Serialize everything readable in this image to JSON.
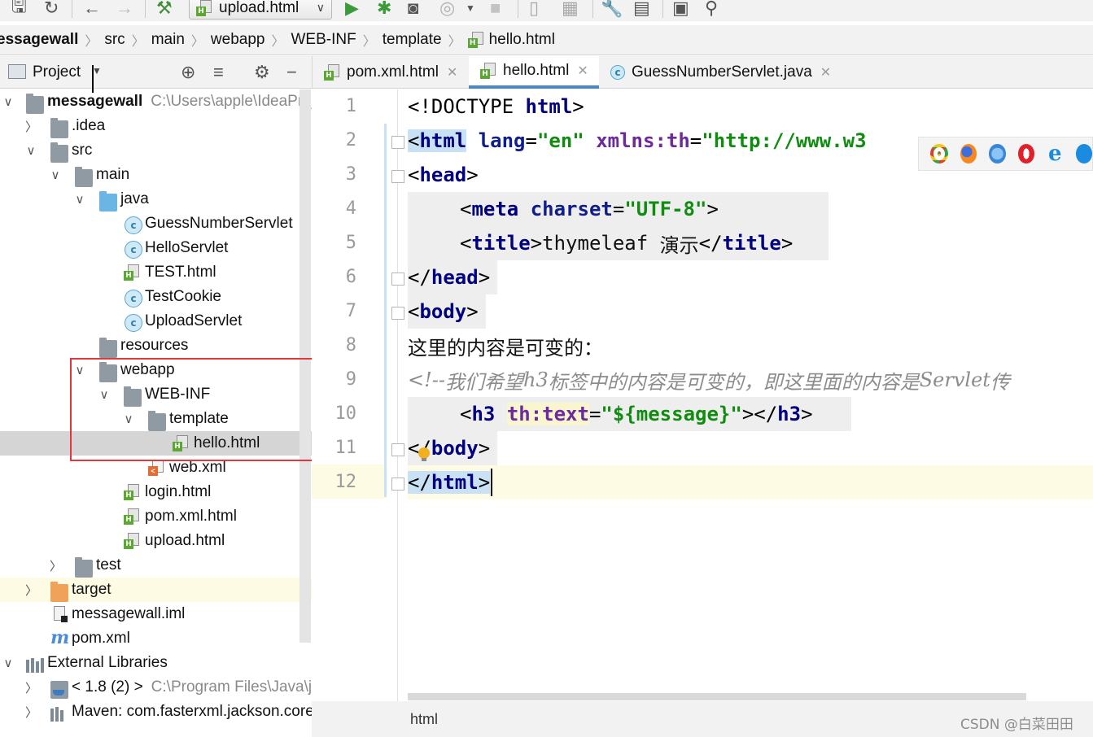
{
  "toolbar": {
    "run_config": "upload.html",
    "icons": [
      "save-icon",
      "sync-icon",
      "back-icon",
      "forward-icon",
      "build-hammer-icon",
      "run-icon",
      "debug-icon",
      "coverage-icon",
      "profile-icon",
      "stop-icon",
      "device-icon",
      "sdk-icon",
      "settings-wrench-icon",
      "project-structure-icon",
      "terminal-icon",
      "search-icon"
    ]
  },
  "breadcrumb": [
    "essagewall",
    "src",
    "main",
    "webapp",
    "WEB-INF",
    "template",
    "hello.html"
  ],
  "project_panel": {
    "title": "Project",
    "tree": [
      {
        "label": "messagewall",
        "path": "C:\\Users\\apple\\IdeaProj"
      },
      {
        "label": ".idea"
      },
      {
        "label": "src"
      },
      {
        "label": "main"
      },
      {
        "label": "java"
      },
      {
        "label": "GuessNumberServlet"
      },
      {
        "label": "HelloServlet"
      },
      {
        "label": "TEST.html"
      },
      {
        "label": "TestCookie"
      },
      {
        "label": "UploadServlet"
      },
      {
        "label": "resources"
      },
      {
        "label": "webapp"
      },
      {
        "label": "WEB-INF"
      },
      {
        "label": "template"
      },
      {
        "label": "hello.html"
      },
      {
        "label": "web.xml"
      },
      {
        "label": "login.html"
      },
      {
        "label": "pom.xml.html"
      },
      {
        "label": "upload.html"
      },
      {
        "label": "test"
      },
      {
        "label": "target"
      },
      {
        "label": "messagewall.iml"
      },
      {
        "label": "pom.xml"
      },
      {
        "label": "External Libraries"
      },
      {
        "label": "< 1.8 (2) >",
        "path": "C:\\Program Files\\Java\\j"
      },
      {
        "label": "Maven: com.fasterxml.jackson.core"
      }
    ]
  },
  "tabs": [
    {
      "label": "pom.xml.html"
    },
    {
      "label": "hello.html"
    },
    {
      "label": "GuessNumberServlet.java"
    }
  ],
  "editor": {
    "line_numbers": [
      "1",
      "2",
      "3",
      "4",
      "5",
      "6",
      "7",
      "8",
      "9",
      "10",
      "11",
      "12"
    ],
    "tokens": {
      "l1": [
        "<!DOCTYPE ",
        "html",
        ">"
      ],
      "l2": [
        "<",
        "html",
        " ",
        "lang",
        "=",
        "\"en\"",
        " ",
        "xmlns:th",
        "=",
        "\"http://www.w3"
      ],
      "l3": [
        "<",
        "head",
        ">"
      ],
      "l4": [
        "<",
        "meta",
        " ",
        "charset",
        "=",
        "\"UTF-8\"",
        ">"
      ],
      "l5": [
        "<",
        "title",
        ">",
        "thymeleaf ",
        "演示",
        "</",
        "title",
        ">"
      ],
      "l6": [
        "</",
        "head",
        ">"
      ],
      "l7": [
        "<",
        "body",
        ">"
      ],
      "l8": "这里的内容是可变的：",
      "l9": [
        "<!--",
        "我们希望",
        "h3",
        "标签中的内容是可变的，即这里面的内容是",
        "Servlet",
        "传"
      ],
      "l10": [
        "<",
        "h3",
        " ",
        "th:text",
        "=",
        "\"${message}\"",
        "></",
        "h3",
        ">"
      ],
      "l11": [
        "<",
        "/",
        "body",
        ">"
      ],
      "l12": [
        "</",
        "html",
        ">"
      ]
    }
  },
  "statusline": {
    "crumb": "html"
  },
  "watermark": "CSDN @白菜田田",
  "colors": {
    "tag": "#000080",
    "value": "#108d10",
    "attr": "#0f1e8a",
    "comment": "#8c8c8c",
    "highlight_box": "#e0383c",
    "active_tab": "#4a88c7"
  }
}
